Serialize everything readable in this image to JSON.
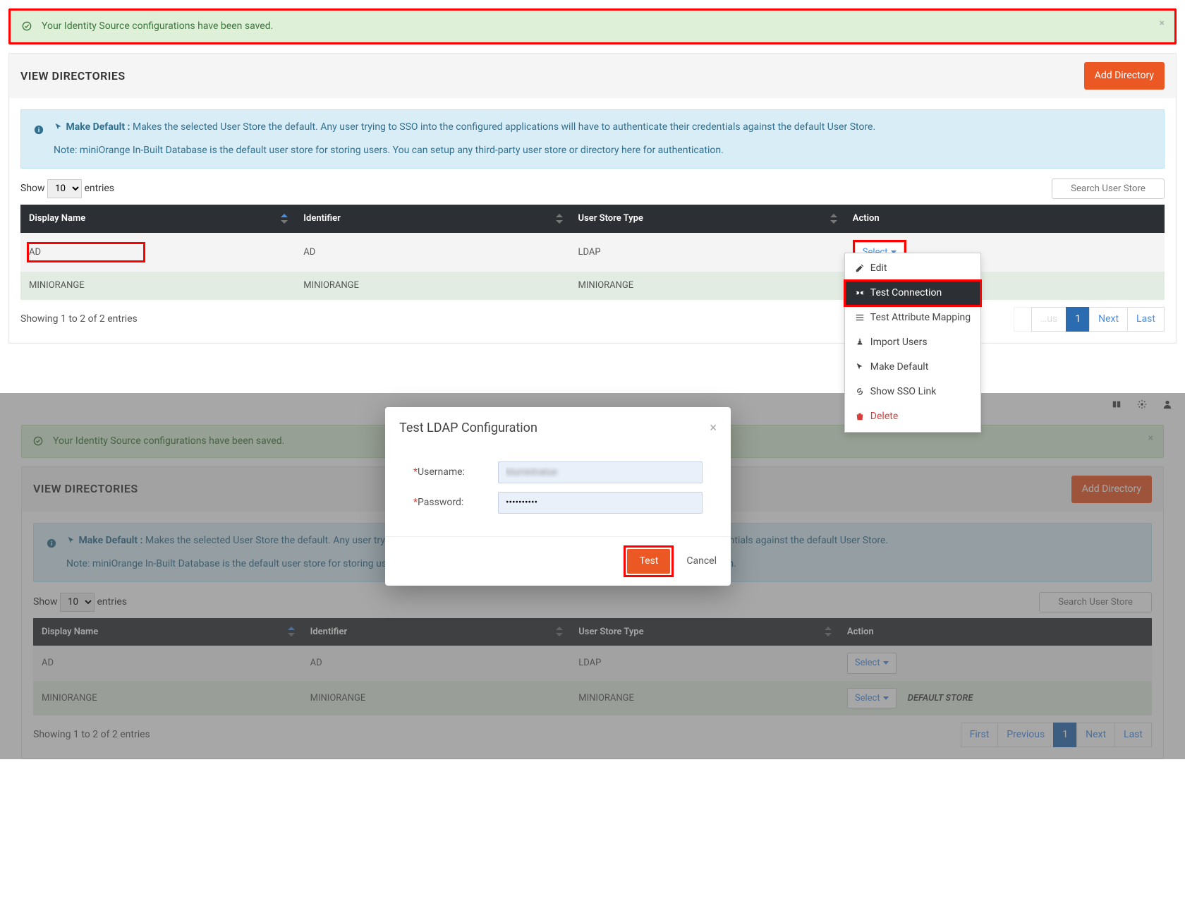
{
  "alert": {
    "message": "Your Identity Source configurations have been saved."
  },
  "panel": {
    "title": "VIEW DIRECTORIES",
    "add_btn": "Add Directory"
  },
  "info": {
    "make_default_label": "Make Default :",
    "make_default_text": "Makes the selected User Store the default. Any user trying to SSO into the configured applications will have to authenticate their credentials against the default User Store.",
    "note": "Note: miniOrange In-Built Database is the default user store for storing users. You can setup any third-party user store or directory here for authentication."
  },
  "table": {
    "show_label": "Show",
    "entries_label": "entries",
    "show_value": "10",
    "search_placeholder": "Search User Store",
    "cols": {
      "display_name": "Display Name",
      "identifier": "Identifier",
      "user_store_type": "User Store Type",
      "action": "Action"
    },
    "rows": [
      {
        "display": "AD",
        "identifier": "AD",
        "type": "LDAP",
        "select_label": "Select",
        "highlighted_dn": true,
        "has_dropdown": true,
        "default_store": ""
      },
      {
        "display": "MINIORANGE",
        "identifier": "MINIORANGE",
        "type": "MINIORANGE",
        "select_label": "Select",
        "highlighted_dn": false,
        "has_dropdown": false,
        "default_store": ""
      }
    ],
    "showing": "Showing 1 to 2 of 2 entries",
    "pagination": {
      "first": "First",
      "prev": "Previous",
      "current": "1",
      "next": "Next",
      "last": "Last"
    }
  },
  "dropdown": {
    "edit": "Edit",
    "test_connection": "Test Connection",
    "test_attr": "Test Attribute Mapping",
    "import_users": "Import Users",
    "make_default": "Make Default",
    "show_sso": "Show SSO Link",
    "delete": "Delete"
  },
  "shot2": {
    "alert_partial": "Your Identity Source configurations",
    "default_store_label": "DEFAULT STORE"
  },
  "modal": {
    "title": "Test LDAP Configuration",
    "username_label": "Username:",
    "password_label": "Password:",
    "username_value": "blurredvalue",
    "password_value": "••••••••••",
    "test": "Test",
    "cancel": "Cancel"
  }
}
